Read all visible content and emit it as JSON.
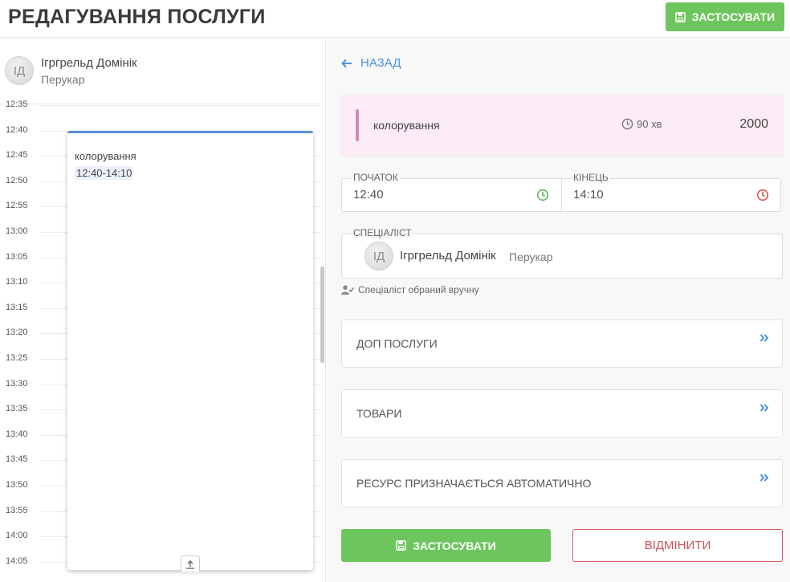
{
  "header": {
    "title": "РЕДАГУВАННЯ ПОСЛУГИ",
    "apply_label": "ЗАСТОСУВАТИ"
  },
  "staff": {
    "initials": "ІД",
    "name": "Ігргрельд Домінік",
    "role": "Перукар"
  },
  "timeline": {
    "slots": [
      "12:35",
      "12:40",
      "12:45",
      "12:50",
      "12:55",
      "13:00",
      "13:05",
      "13:10",
      "13:15",
      "13:20",
      "13:25",
      "13:30",
      "13:35",
      "13:40",
      "13:45",
      "13:50",
      "13:55",
      "14:00",
      "14:05"
    ]
  },
  "event": {
    "name": "колорування",
    "time": "12:40-14:10",
    "accent_color": "#5b8fd8"
  },
  "back_label": "НАЗАД",
  "service": {
    "name": "колорування",
    "duration": "90 хв",
    "price": "2000",
    "bg_color": "#fcecf5",
    "bar_color": "#d587c0"
  },
  "start": {
    "label": "ПОЧАТОК",
    "value": "12:40"
  },
  "end": {
    "label": "КІНЕЦЬ",
    "value": "14:10"
  },
  "specialist": {
    "label": "СПЕЦІАЛІСТ",
    "initials": "ІД",
    "name": "Ігргрельд Домінік",
    "role": "Перукар",
    "manual_note": "Спеціаліст обраний вручну"
  },
  "panels": [
    {
      "title": "ДОП ПОСЛУГИ"
    },
    {
      "title": "ТОВАРИ"
    },
    {
      "title": "РЕСУРС ПРИЗНАЧАЄТЬСЯ АВТОМАТИЧНО"
    }
  ],
  "footer": {
    "apply_label": "ЗАСТОСУВАТИ",
    "cancel_label": "ВІДМІНИТИ"
  },
  "colors": {
    "primary_green": "#6cc65d",
    "link_blue": "#4a90e2",
    "danger_red": "#d0545b"
  },
  "icons": {
    "save": "floppy-disk-icon",
    "back": "arrow-left-icon",
    "clock": "clock-icon",
    "user_check": "user-check-icon",
    "chevron": "double-chevron-right-icon",
    "resize": "arrow-up-icon"
  }
}
